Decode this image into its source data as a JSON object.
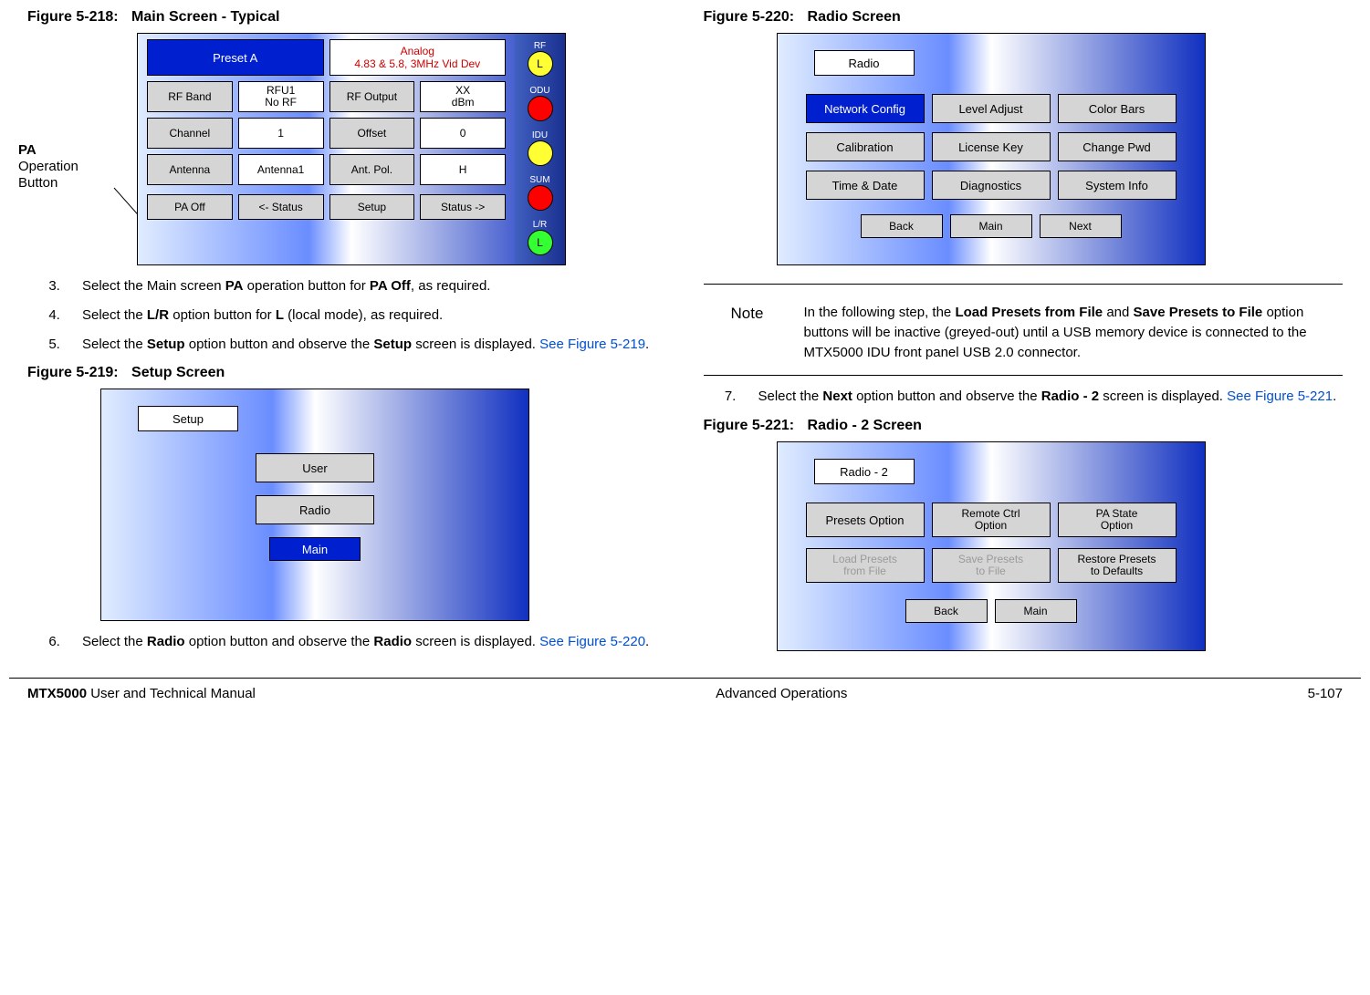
{
  "left": {
    "fig218": {
      "label": "Figure 5-218:",
      "title": "Main Screen - Typical",
      "callout_bold": "PA",
      "callout_rest1": "Operation",
      "callout_rest2": "Button",
      "preset": "Preset A",
      "analog_l1": "Analog",
      "analog_l2": "4.83 & 5.8, 3MHz Vid Dev",
      "row1": {
        "a": "RF Band",
        "b1": "RFU1",
        "b2": "No RF",
        "c": "RF Output",
        "d1": "XX",
        "d2": "dBm"
      },
      "row2": {
        "a": "Channel",
        "b": "1",
        "c": "Offset",
        "d": "0"
      },
      "row3": {
        "a": "Antenna",
        "b": "Antenna1",
        "c": "Ant. Pol.",
        "d": "H"
      },
      "row4": {
        "a": "PA Off",
        "b": "<- Status",
        "c": "Setup",
        "d": "Status ->"
      },
      "side": {
        "rf": "RF",
        "rf_led": "L",
        "odu": "ODU",
        "idu": "IDU",
        "sum": "SUM",
        "lr": "L/R",
        "lr_led": "L"
      }
    },
    "steps1": {
      "start": 3,
      "s3a": "Select the Main screen ",
      "s3b": "PA",
      "s3c": " operation button for ",
      "s3d": "PA Off",
      "s3e": ", as required.",
      "s4a": "Select the ",
      "s4b": "L/R",
      "s4c": " option button for ",
      "s4d": "L",
      "s4e": " (local mode), as required.",
      "s5a": "Select the ",
      "s5b": "Setup",
      "s5c": " option button and observe the ",
      "s5d": "Setup",
      "s5e": " screen is displayed.  ",
      "s5link": "See Figure 5-219",
      "s5f": "."
    },
    "fig219": {
      "label": "Figure 5-219:",
      "title": "Setup Screen",
      "box": "Setup",
      "btn_user": "User",
      "btn_radio": "Radio",
      "btn_main": "Main"
    },
    "steps2": {
      "start": 6,
      "s6a": "Select the ",
      "s6b": "Radio",
      "s6c": " option button and observe the ",
      "s6d": "Radio",
      "s6e": " screen is displayed.  ",
      "s6link": "See Figure 5-220",
      "s6f": "."
    }
  },
  "right": {
    "fig220": {
      "label": "Figure 5-220:",
      "title": "Radio Screen",
      "box": "Radio",
      "r1": {
        "a": "Network Config",
        "b": "Level Adjust",
        "c": "Color Bars"
      },
      "r2": {
        "a": "Calibration",
        "b": "License Key",
        "c": "Change Pwd"
      },
      "r3": {
        "a": "Time & Date",
        "b": "Diagnostics",
        "c": "System Info"
      },
      "bot": {
        "a": "Back",
        "b": "Main",
        "c": "Next"
      }
    },
    "note": {
      "label": "Note",
      "t1": "In the following step, the ",
      "b1": "Load Presets from File",
      "t2": " and ",
      "b2": "Save Presets to File",
      "t3": " option buttons will be inactive (greyed-out) until a USB memory device is connected to the MTX5000 IDU front panel USB 2.0 connector."
    },
    "steps3": {
      "start": 7,
      "s7a": "Select the ",
      "s7b": "Next",
      "s7c": " option button and observe the ",
      "s7d": "Radio - 2",
      "s7e": " screen is displayed.  ",
      "s7link": "See Figure 5-221",
      "s7f": "."
    },
    "fig221": {
      "label": "Figure 5-221:",
      "title": "Radio - 2 Screen",
      "box": "Radio - 2",
      "r1": {
        "a": "Presets Option",
        "b1": "Remote Ctrl",
        "b2": "Option",
        "c1": "PA State",
        "c2": "Option"
      },
      "r2": {
        "a1": "Load Presets",
        "a2": "from File",
        "b1": "Save Presets",
        "b2": "to File",
        "c1": "Restore Presets",
        "c2": "to Defaults"
      },
      "bot": {
        "a": "Back",
        "b": "Main"
      }
    }
  },
  "footer": {
    "left_bold": "MTX5000",
    "left_rest": " User and Technical Manual",
    "center": "Advanced Operations",
    "right": "5-107"
  }
}
